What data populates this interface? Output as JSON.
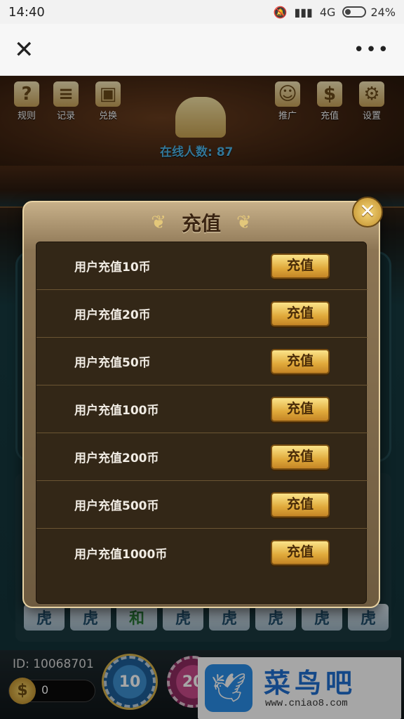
{
  "status_bar": {
    "time": "14:40",
    "network": "4G",
    "battery": "24%"
  },
  "nav": {
    "close_icon": "close-icon",
    "more_icon": "more-icon"
  },
  "game": {
    "top_left_items": [
      {
        "label": "规则",
        "icon": "question-icon",
        "glyph": "?"
      },
      {
        "label": "记录",
        "icon": "notepad-icon",
        "glyph": "≡"
      },
      {
        "label": "兑换",
        "icon": "gift-icon",
        "glyph": "▣"
      }
    ],
    "top_right_items": [
      {
        "label": "推广",
        "icon": "people-icon",
        "glyph": "☺"
      },
      {
        "label": "充值",
        "icon": "money-bag-icon",
        "glyph": "$"
      },
      {
        "label": "设置",
        "icon": "gear-icon",
        "glyph": "⚙"
      }
    ],
    "online_count_text": "在线人数: 87",
    "tiger_tiles": [
      "虎",
      "虎",
      "和",
      "虎",
      "虎",
      "虎",
      "虎",
      "虎"
    ],
    "user_id": "ID: 10068701",
    "coin_balance": "0",
    "chips": [
      "10",
      "20"
    ]
  },
  "modal": {
    "title": "充值",
    "rows": [
      {
        "label": "用户充值10币",
        "button": "充值"
      },
      {
        "label": "用户充值20币",
        "button": "充值"
      },
      {
        "label": "用户充值50币",
        "button": "充值"
      },
      {
        "label": "用户充值100币",
        "button": "充值"
      },
      {
        "label": "用户充值200币",
        "button": "充值"
      },
      {
        "label": "用户充值500币",
        "button": "充值"
      },
      {
        "label": "用户充值1000币",
        "button": "充值"
      }
    ]
  },
  "watermark": {
    "title": "菜鸟吧",
    "url": "www.cniao8.com"
  }
}
